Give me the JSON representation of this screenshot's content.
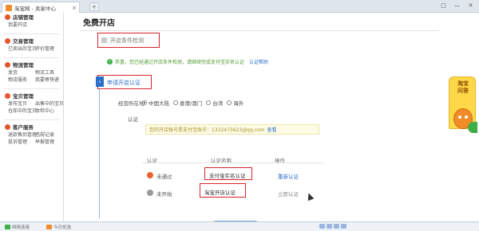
{
  "browser": {
    "tab_title": "淘宝网 - 卖家中心",
    "tab_close": "×",
    "new_tab": "+",
    "window_controls": [
      "□",
      "—",
      "✕"
    ]
  },
  "sidebar": {
    "groups": [
      {
        "title": "店铺管理",
        "rows": [
          [
            "我要开店"
          ]
        ]
      },
      {
        "title": "交易管理",
        "rows": [
          [
            "已卖出的宝贝",
            "评价管理"
          ]
        ]
      },
      {
        "title": "物流管理",
        "rows": [
          [
            "发货",
            "物流工具"
          ],
          [
            "物流服务",
            "我要寄快递"
          ]
        ]
      },
      {
        "title": "宝贝管理",
        "rows": [
          [
            "发布宝贝",
            "出售中的宝贝"
          ],
          [
            "仓库中的宝贝",
            "体检中心"
          ]
        ]
      },
      {
        "title": "客户服务",
        "rows": [
          [
            "退款售后管理",
            "违规记录"
          ],
          [
            "投诉管理",
            "举报管理"
          ]
        ]
      }
    ]
  },
  "main": {
    "title": "免费开店",
    "step1": {
      "label": "开店条件检测",
      "note": "恭喜，您已经通过开店条件检测，请继续完成支付宝实名认证",
      "note_link": "认证帮助"
    },
    "step2": {
      "arrow": "›",
      "label": "申请开店认证",
      "location_label": "经营所在地",
      "location_options": [
        "中国大陆",
        "香港/澳门",
        "台湾",
        "海外"
      ],
      "location_selected": 0,
      "auth_label": "认证",
      "notice": "您的开店账号是支付宝账号：1332473623@qq.com",
      "notice_link": "查看"
    },
    "table": {
      "headers": [
        "认证",
        "认证名称",
        "操作"
      ],
      "rows": [
        {
          "status": "未通过",
          "name": "支付宝实名认证",
          "action": "重新认证"
        },
        {
          "status": "未开始",
          "name": "淘宝开店认证",
          "action": "立即认证"
        }
      ]
    }
  },
  "support": {
    "label": "淘宝\n问答"
  },
  "statusbar": {
    "items": [
      "网络连接",
      "今日优选"
    ],
    "colors": [
      "#3fae49",
      "#f28c28"
    ]
  },
  "colors": {
    "accent": "#2a6fc9",
    "highlight_box": "#d8242b",
    "success": "#3fae49"
  }
}
